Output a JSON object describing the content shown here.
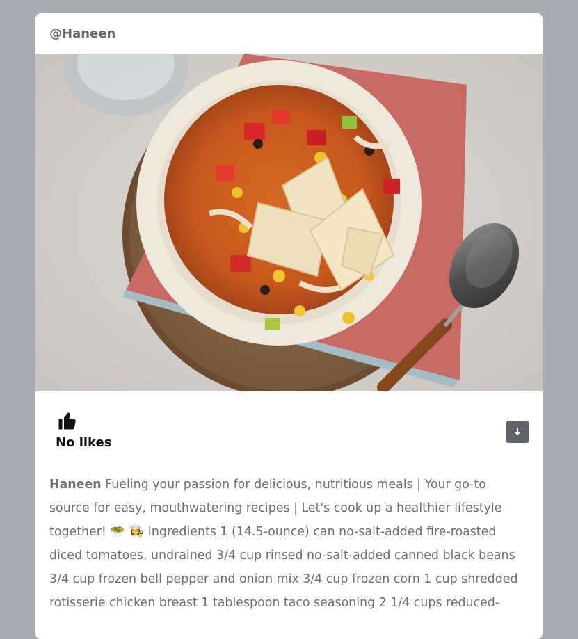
{
  "post": {
    "header_username": "@Haneen",
    "image_alt": "Chicken tortilla soup in a bowl",
    "likes_text": "No likes",
    "caption_author": "Haneen",
    "caption_text": "Fueling your passion for delicious, nutritious meals | Your go-to source for easy, mouthwatering recipes | Let's cook up a healthier lifestyle together! 🥗 👩‍🍳 Ingredients 1 (14.5-ounce) can no-salt-added fire-roasted diced tomatoes, undrained 3/4 cup rinsed no-salt-added canned black beans 3/4 cup frozen bell pepper and onion mix 3/4 cup frozen corn 1 cup shredded rotisserie chicken breast 1 tablespoon taco seasoning 2 1/4 cups reduced-"
  },
  "icons": {
    "like": "thumbs-up-icon",
    "download": "download-icon"
  },
  "colors": {
    "background": "#a9acb2",
    "card": "#ffffff",
    "text_muted": "#6b6f75",
    "download_button": "#5f6368"
  }
}
